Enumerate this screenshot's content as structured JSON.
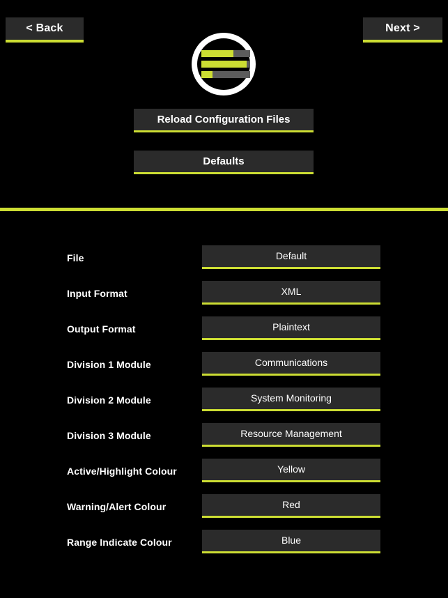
{
  "theme": {
    "background": "#000000",
    "panel": "#2b2b2b",
    "accent": "#ccdd33",
    "bar_track": "#5c5c5c",
    "text": "#ffffff"
  },
  "nav": {
    "back_label": "< Back",
    "next_label": "Next >"
  },
  "logo": {
    "name": "three-bar-circle-logo",
    "ring_color": "#ffffff",
    "bars": [
      {
        "fill_percent": 66
      },
      {
        "fill_percent": 93
      },
      {
        "fill_percent": 23
      }
    ]
  },
  "actions": {
    "reload_label": "Reload Configuration Files",
    "defaults_label": "Defaults"
  },
  "settings": {
    "rows": [
      {
        "label": "File",
        "value": "Default"
      },
      {
        "label": "Input Format",
        "value": "XML"
      },
      {
        "label": "Output Format",
        "value": "Plaintext"
      },
      {
        "label": "Division 1 Module",
        "value": "Communications"
      },
      {
        "label": "Division 2 Module",
        "value": "System Monitoring"
      },
      {
        "label": "Division 3 Module",
        "value": "Resource Management"
      },
      {
        "label": "Active/Highlight Colour",
        "value": "Yellow"
      },
      {
        "label": "Warning/Alert Colour",
        "value": "Red"
      },
      {
        "label": "Range Indicate Colour",
        "value": "Blue"
      }
    ]
  }
}
